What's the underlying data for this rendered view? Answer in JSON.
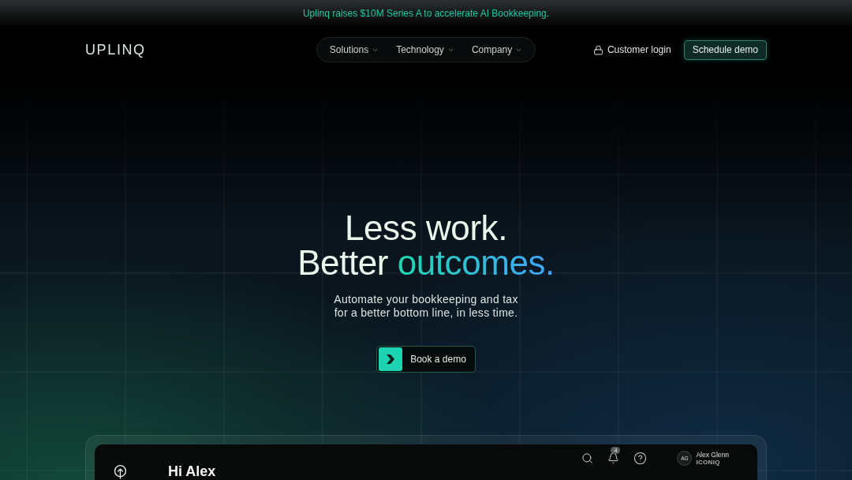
{
  "announcement": {
    "text": "Uplinq raises $10M Series A to accelerate AI Bookkeeping."
  },
  "nav": {
    "logo": "UPLINQ",
    "items": [
      {
        "label": "Solutions"
      },
      {
        "label": "Technology"
      },
      {
        "label": "Company"
      }
    ],
    "login": "Customer login",
    "cta": "Schedule demo"
  },
  "hero": {
    "headline": {
      "line_1": "Less work.",
      "line_2": "Better",
      "highlight": "outcomes."
    },
    "subtitle_lines": [
      "Automate your bookkeeping and tax",
      "for a better bottom line, in less time."
    ],
    "cta": "Book a demo"
  },
  "dashboard": {
    "greeting": "Hi Alex",
    "notifications": "4",
    "user": {
      "initials": "AG",
      "name": "Alex Glenn",
      "company": "ICONIQ"
    }
  }
}
